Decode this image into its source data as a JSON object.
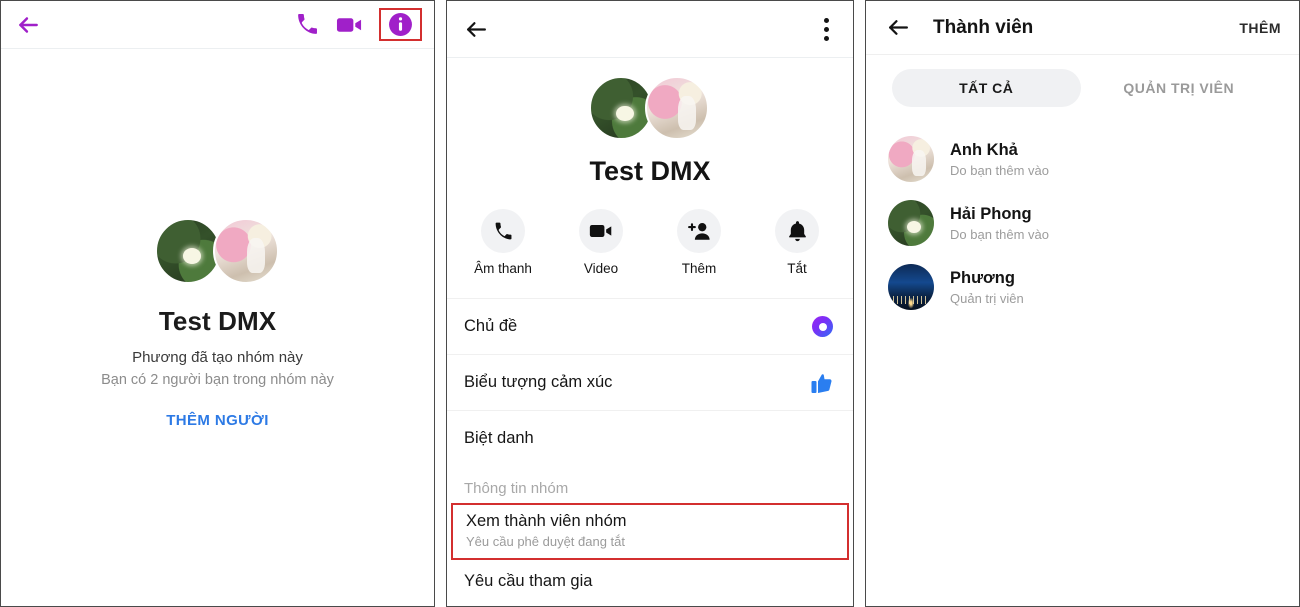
{
  "panel1": {
    "header": {
      "back_icon": "arrow-left-icon",
      "call_icon": "phone-icon",
      "video_icon": "video-camera-icon",
      "info_icon": "info-circle-icon",
      "accent_color": "#a020c9",
      "highlight_color": "#d32f2f"
    },
    "group_title": "Test DMX",
    "subtitle_created": "Phương đã tạo nhóm này",
    "subtitle_friends": "Bạn có 2 người bạn trong nhóm này",
    "add_people_label": "THÊM NGƯỜI",
    "add_people_color": "#2d7ae5",
    "avatars": [
      "lotus-flower-avatar",
      "girl-photo-avatar"
    ]
  },
  "panel2": {
    "header": {
      "back_icon": "arrow-left-icon",
      "menu_icon": "more-vertical-icon"
    },
    "group_title": "Test DMX",
    "avatars": [
      "lotus-flower-avatar",
      "girl-photo-avatar"
    ],
    "actions": [
      {
        "label": "Âm thanh",
        "icon": "phone-icon"
      },
      {
        "label": "Video",
        "icon": "video-camera-icon"
      },
      {
        "label": "Thêm",
        "icon": "add-person-icon"
      },
      {
        "label": "Tắt",
        "icon": "bell-icon"
      }
    ],
    "rows": [
      {
        "label": "Chủ đề",
        "icon": "theme-ring-icon"
      },
      {
        "label": "Biểu tượng cảm xúc",
        "icon": "thumbs-up-icon"
      },
      {
        "label": "Biệt danh",
        "icon": ""
      }
    ],
    "section_header": "Thông tin nhóm",
    "highlighted_row": {
      "title": "Xem thành viên nhóm",
      "subtitle": "Yêu cầu phê duyệt đang tắt"
    },
    "cut_off_row": "Yêu cầu tham gia",
    "theme_color": "#7b2ff7",
    "reaction_color": "#2a7ef0",
    "highlight_color": "#d32f2f"
  },
  "panel3": {
    "header": {
      "back_icon": "arrow-left-icon",
      "title": "Thành viên",
      "add_label": "THÊM"
    },
    "tabs": [
      {
        "label": "TẤT CẢ",
        "active": true
      },
      {
        "label": "QUẢN TRỊ VIÊN",
        "active": false
      }
    ],
    "members": [
      {
        "name": "Anh Khả",
        "role": "Do bạn thêm vào",
        "avatar": "girl-photo-avatar"
      },
      {
        "name": "Hải Phong",
        "role": "Do bạn thêm vào",
        "avatar": "lotus-flower-avatar"
      },
      {
        "name": "Phương",
        "role": "Quản trị viên",
        "avatar": "night-city-avatar"
      }
    ]
  }
}
